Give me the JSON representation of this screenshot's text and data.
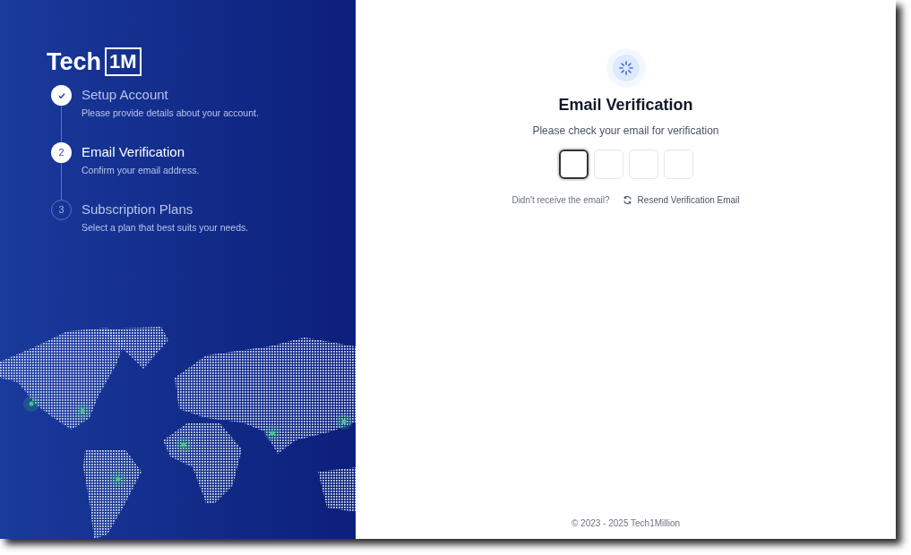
{
  "logo": {
    "text": "Tech",
    "badge": "1M"
  },
  "steps": [
    {
      "kind": "done",
      "title": "Setup Account",
      "description": "Please provide details about your account."
    },
    {
      "kind": "current",
      "number": "2",
      "title": "Email Verification",
      "description": "Confirm your email address."
    },
    {
      "kind": "upcoming",
      "number": "3",
      "title": "Subscription Plans",
      "description": "Select a plan that best suits your needs."
    }
  ],
  "verification": {
    "title": "Email Verification",
    "subtitle": "Please check your email for verification",
    "code_boxes": [
      {
        "focused": true
      },
      {
        "focused": false
      },
      {
        "focused": false
      },
      {
        "focused": false
      }
    ],
    "resend_prompt": "Didn't receive the email?",
    "resend_link": "Resend Verification Email"
  },
  "footer": "© 2023 - 2025 Tech1Million"
}
